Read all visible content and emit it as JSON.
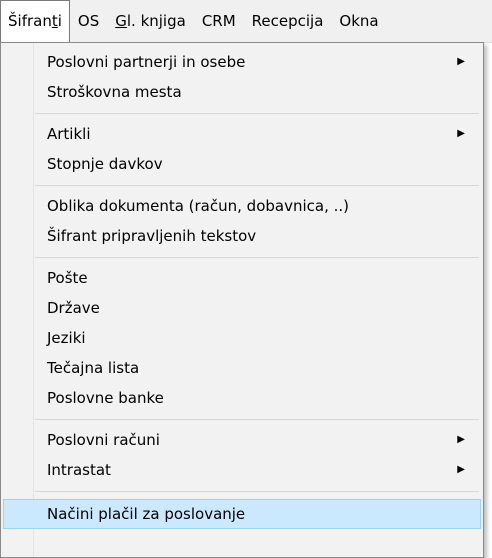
{
  "menubar": {
    "items": [
      {
        "pre": "Šifran",
        "u": "t",
        "post": "i"
      },
      {
        "pre": "OS",
        "u": "",
        "post": ""
      },
      {
        "pre": "",
        "u": "G",
        "post": "l. knjiga"
      },
      {
        "pre": "CRM",
        "u": "",
        "post": ""
      },
      {
        "pre": "Recepcija",
        "u": "",
        "post": ""
      },
      {
        "pre": "Okna",
        "u": "",
        "post": ""
      }
    ]
  },
  "dropdown": {
    "items": [
      {
        "label": "Poslovni partnerji in osebe",
        "submenu": true
      },
      {
        "label": "Stroškovna mesta",
        "submenu": false
      },
      {
        "label": "Artikli",
        "submenu": true
      },
      {
        "label": "Stopnje davkov",
        "submenu": false
      },
      {
        "label": "Oblika dokumenta (račun, dobavnica, ..)",
        "submenu": false
      },
      {
        "label": "Šifrant pripravljenih tekstov",
        "submenu": false
      },
      {
        "label": "Pošte",
        "submenu": false
      },
      {
        "label": "Države",
        "submenu": false
      },
      {
        "label": "Jeziki",
        "submenu": false
      },
      {
        "label": "Tečajna lista",
        "submenu": false
      },
      {
        "label": "Poslovne banke",
        "submenu": false
      },
      {
        "label": "Poslovni računi",
        "submenu": true
      },
      {
        "label": "Intrastat",
        "submenu": true
      },
      {
        "label": "Načini plačil za poslovanje",
        "submenu": false,
        "highlighted": true
      }
    ],
    "submenu_arrow_icon": "triangle-right-icon"
  },
  "colors": {
    "menubar_bg": "#f0f0f0",
    "dropdown_bg": "#f2f2f2",
    "highlight_bg": "#cce8ff",
    "highlight_border": "#99d1ff"
  }
}
